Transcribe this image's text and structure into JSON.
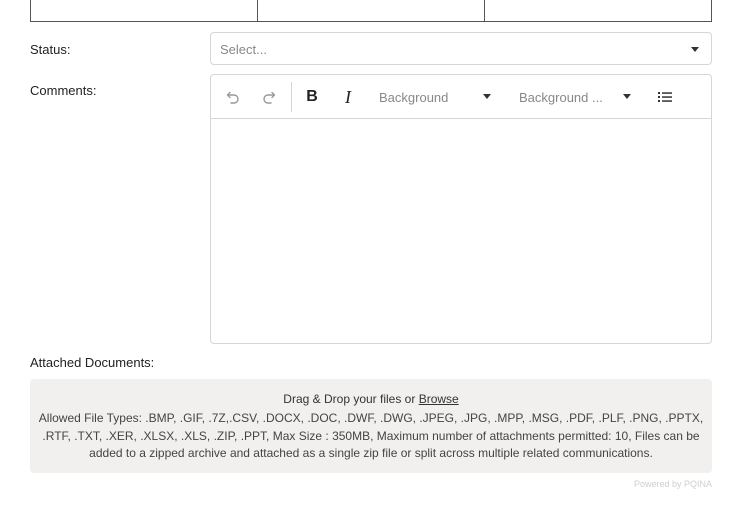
{
  "form": {
    "status_label": "Status:",
    "status_placeholder": "Select...",
    "comments_label": "Comments:",
    "attachments_label": "Attached Documents:"
  },
  "editor": {
    "toolbar": {
      "bold_label": "B",
      "italic_label": "I",
      "background_dropdown_1": "Background",
      "background_dropdown_2": "Background ...",
      "icons": [
        "undo-icon",
        "redo-icon",
        "bold-icon",
        "italic-icon",
        "bullet-list-icon"
      ]
    }
  },
  "dropzone": {
    "title_prefix": "Drag & Drop your files or ",
    "browse_link": "Browse",
    "info": "Allowed File Types: .BMP, .GIF, .7Z,.CSV, .DOCX, .DOC, .DWF, .DWG, .JPEG, .JPG, .MPP, .MSG, .PDF, .PLF, .PNG, .PPTX, .RTF, .TXT, .XER, .XLSX, .XLS, .ZIP, .PPT, Max Size : 350MB, Maximum number of attachments permitted: 10, Files can be added to a zipped archive and attached as a single zip file or split across multiple related communications."
  },
  "footer": {
    "powered_by": "Powered by PQINA"
  }
}
